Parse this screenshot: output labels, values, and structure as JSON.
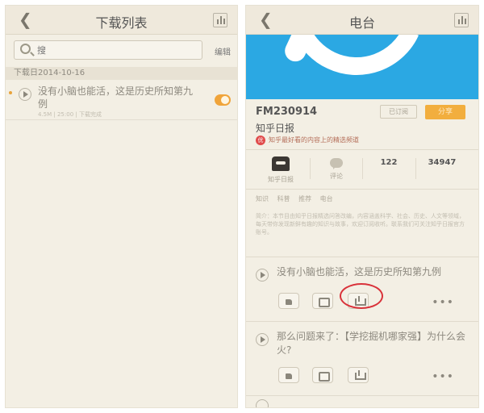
{
  "left": {
    "title": "下载列表",
    "search_placeholder": "搜",
    "edit_label": "编辑",
    "date_header": "下载日2014-10-16",
    "item": {
      "title": "没有小脑也能活，这是历史所知第九例",
      "meta": "4.5M | 25:00 | 下载完成"
    }
  },
  "right": {
    "title": "电台",
    "channel_id": "FM230914",
    "channel_name": "知乎日报",
    "btn_subscribe": "已订阅",
    "btn_share": "分享",
    "featured": "知乎最好看的内容上的精选频道",
    "stats": {
      "host_label": "知乎日报",
      "comments_label": "评论",
      "count1": "122",
      "count2": "34947"
    },
    "tags": [
      "知识",
      "科普",
      "推荐",
      "电台"
    ],
    "description": "简介：本节目由知乎日报精选问答改编，内容涵盖科学、社会、历史、人文等领域，每天带你发现新鲜有趣的知识与故事，欢迎订阅收听。联系我们可关注知乎日报官方账号。",
    "episodes": [
      {
        "title": "没有小脑也能活，这是历史所知第九例"
      },
      {
        "title": "那么问题来了：【学挖掘机哪家强】为什么会火?"
      }
    ],
    "more_label": "•••"
  },
  "colors": {
    "accent": "#f2ae3e",
    "cover": "#2ba8e3",
    "highlight_circle": "#d9323a"
  }
}
